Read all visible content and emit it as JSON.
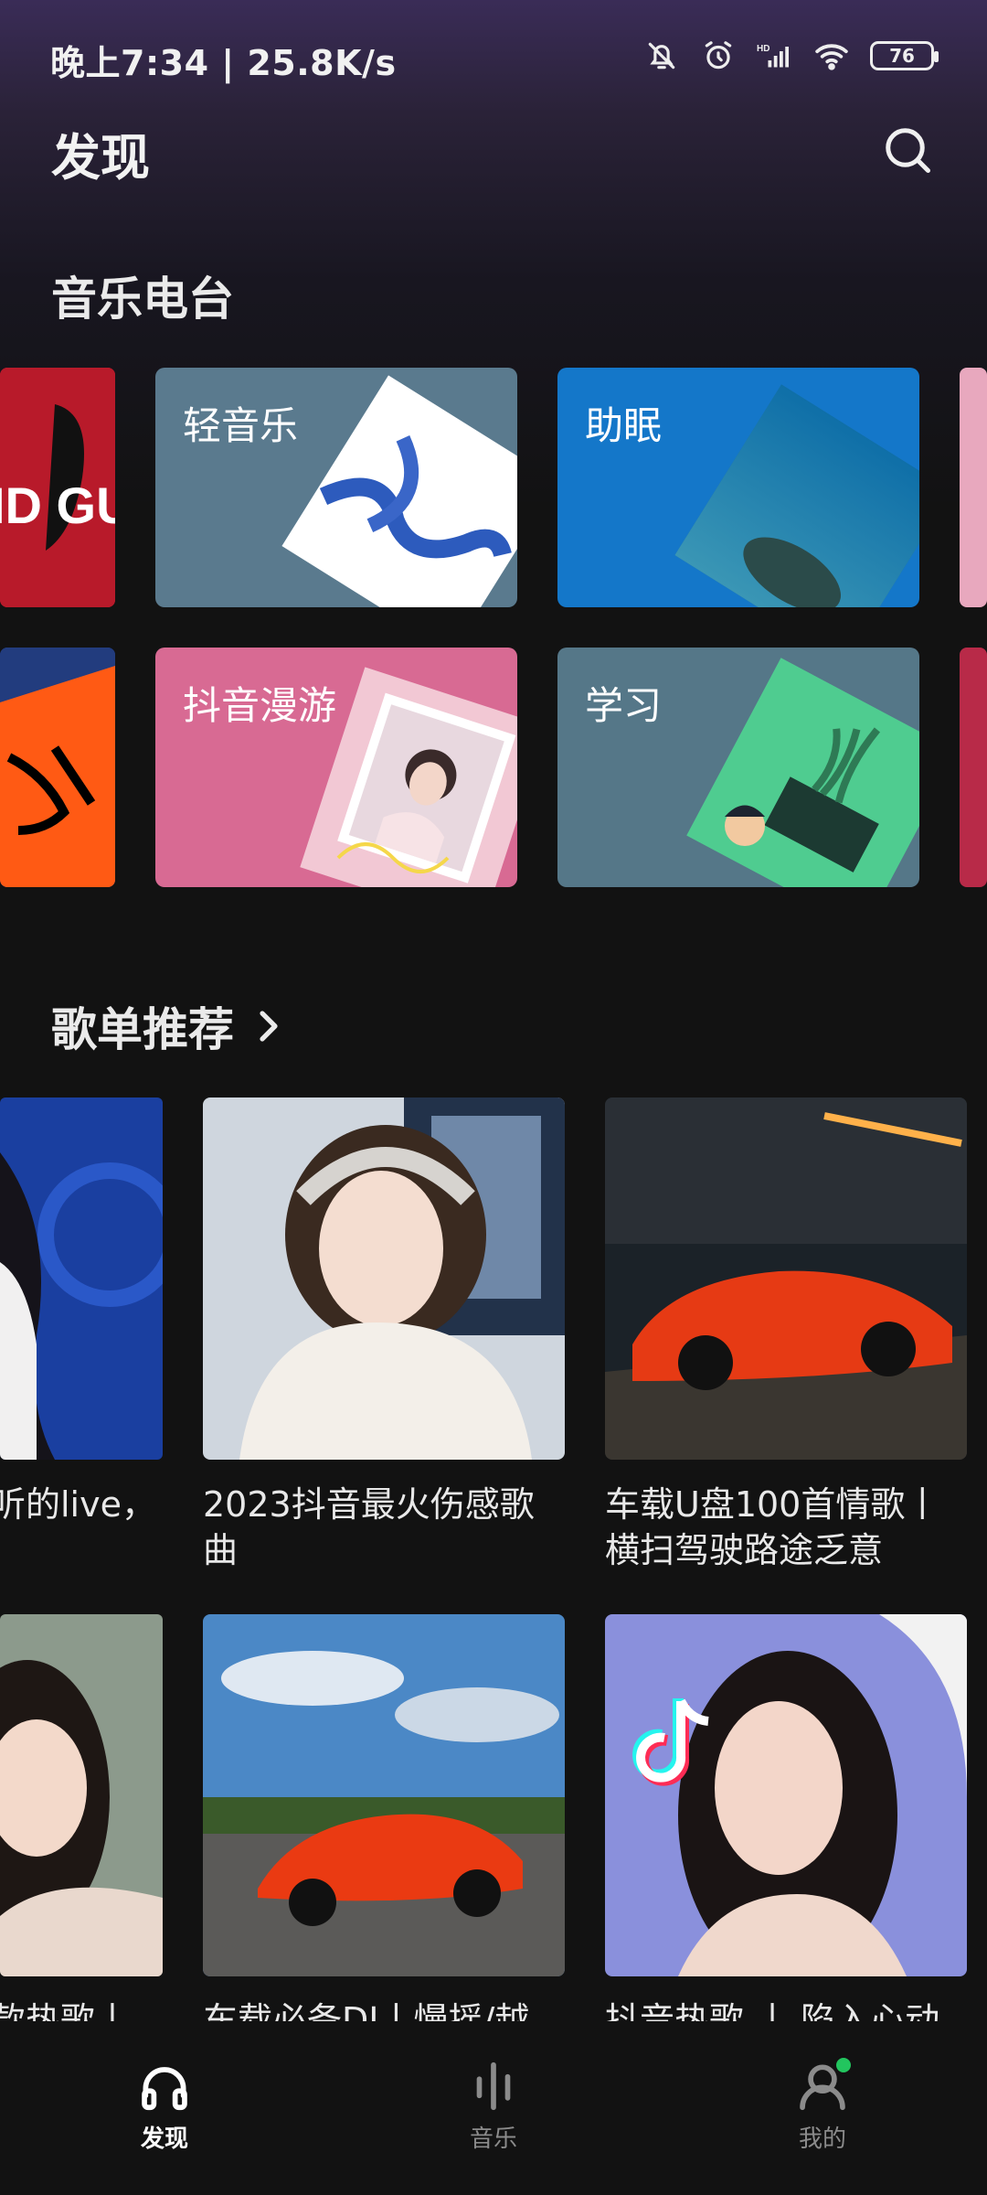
{
  "status_bar": {
    "time_speed": "晚上7:34 | 25.8K/s",
    "battery": "76",
    "icons": [
      "mute-bell-icon",
      "alarm-icon",
      "hd-signal-icon",
      "wifi-icon",
      "battery-icon"
    ]
  },
  "header": {
    "title": "发现",
    "search_icon": "search-icon"
  },
  "radio_section": {
    "title": "音乐电台",
    "cards": [
      {
        "label": "轻音乐",
        "color": "#5a7a8e"
      },
      {
        "label": "助眠",
        "color": "#1477c9"
      },
      {
        "label": "抖音漫游",
        "color": "#d86a93"
      },
      {
        "label": "学习",
        "color": "#557788"
      }
    ]
  },
  "playlist_section": {
    "title": "歌单推荐",
    "arrow_icon": "chevron-right-icon",
    "items": [
      {
        "title": "听的live，"
      },
      {
        "title": "2023抖音最火伤感歌曲"
      },
      {
        "title": "车载U盘100首情歌丨横扫驾驶路途乏意"
      },
      {
        "title": "款热歌丨"
      },
      {
        "title": "车载必备DJ丨慢摇/越"
      },
      {
        "title": "抖音热歌 丨 陷入心动"
      }
    ]
  },
  "bottom_nav": {
    "items": [
      {
        "label": "发现",
        "icon": "headphones-icon",
        "active": true
      },
      {
        "label": "音乐",
        "icon": "equalizer-icon",
        "active": false
      },
      {
        "label": "我的",
        "icon": "user-icon",
        "active": false
      }
    ],
    "notification_dot_color": "#22c55e"
  }
}
